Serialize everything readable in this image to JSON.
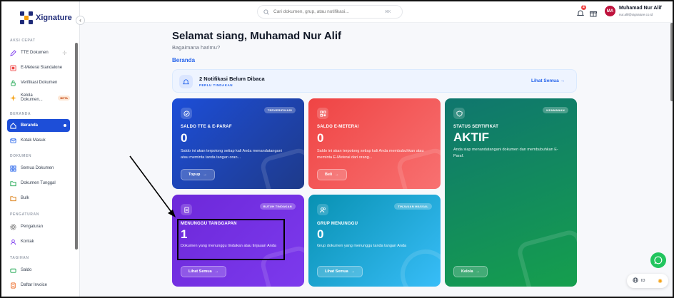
{
  "brand": {
    "name": "Xignature"
  },
  "sidebar": {
    "sections": [
      {
        "title": "AKSI CEPAT",
        "items": [
          {
            "label": "TTE Dokumen"
          },
          {
            "label": "E-Meterai Standalone"
          },
          {
            "label": "Verifikasi Dokumen"
          },
          {
            "label": "Kelola Dokumen...",
            "badge": "BETA"
          }
        ]
      },
      {
        "title": "BERANDA",
        "items": [
          {
            "label": "Beranda",
            "active": true
          },
          {
            "label": "Kotak Masuk"
          }
        ]
      },
      {
        "title": "DOKUMEN",
        "items": [
          {
            "label": "Semua Dokumen"
          },
          {
            "label": "Dokumen Tunggal"
          },
          {
            "label": "Bulk"
          }
        ]
      },
      {
        "title": "PENGATURAN",
        "items": [
          {
            "label": "Pengaturan"
          },
          {
            "label": "Kontak"
          }
        ]
      },
      {
        "title": "TAGIHAN",
        "items": [
          {
            "label": "Saldo"
          },
          {
            "label": "Daftar Invoice"
          }
        ]
      }
    ]
  },
  "topbar": {
    "search_placeholder": "Cari dokumen, grup, atau notifikasi...",
    "search_shortcut": "⌘K",
    "notif_count": "2",
    "user": {
      "initials": "MA",
      "name": "Muhamad Nur Alif",
      "email": "nur.alif@xignature.co.id"
    }
  },
  "main": {
    "greeting": "Selamat siang, Muhamad Nur Alif",
    "subgreeting": "Bagaimana harimu?",
    "breadcrumb": "Beranda",
    "notification": {
      "title": "2 Notifikasi Belum Dibaca",
      "subtitle": "PERLU TINDAKAN",
      "link": "Lihat Semua"
    },
    "cards": {
      "tte": {
        "badge": "TERVERIFIKASI",
        "title": "SALDO TTE & E-PARAF",
        "value": "0",
        "desc": "Saldo ini akan terpotong setiap kali Anda menandatangani atau meminta tanda tangan oran...",
        "button": "Topup"
      },
      "emeterai": {
        "badge": "",
        "title": "SALDO E-METERAI",
        "value": "0",
        "desc": "Saldo ini akan terpotong setiap kali Anda membubuhkan atau meminta E-Meterai dari orang...",
        "button": "Beli"
      },
      "cert": {
        "badge": "KEAMANAN",
        "title": "STATUS SERTIFIKAT",
        "value": "AKTIF",
        "desc": "Anda siap menandatangani dokumen dan membubuhkan E-Paraf.",
        "button": "Kelola"
      },
      "waiting": {
        "badge": "BUTUH TINDAKAN",
        "title": "MENUNGGU TANGGAPAN",
        "value": "1",
        "desc": "Dokumen yang menunggu tindakan atau tinjauan Anda",
        "button": "Lihat Semua"
      },
      "group": {
        "badge": "TINJAUAN MASSAL",
        "title": "GRUP MENUNGGU",
        "value": "0",
        "desc": "Grup dokumen yang menunggu tanda tangan Anda",
        "button": "Lihat Semua"
      }
    }
  },
  "footer": {
    "language": "ID"
  },
  "colors": {
    "primary": "#1d4ed8",
    "emeterai": "#ef4444",
    "cert": "#0f766e",
    "waiting": "#7c3aed",
    "group": "#0891b2"
  }
}
